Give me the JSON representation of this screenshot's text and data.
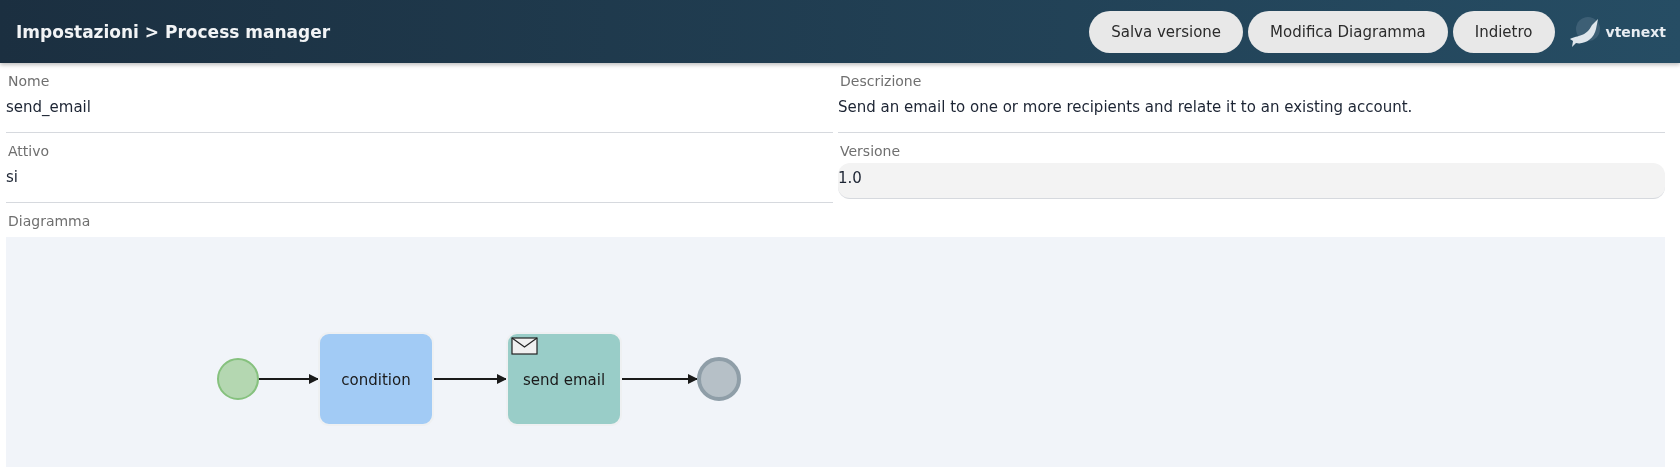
{
  "header": {
    "breadcrumb": "Impostazioni > Process manager",
    "buttons": [
      "Salva versione",
      "Modifica Diagramma",
      "Indietro"
    ],
    "logo": "vtenext"
  },
  "fields": [
    {
      "label": "Nome",
      "value": "send_email",
      "kind": "text"
    },
    {
      "label": "Descrizione",
      "value": "Send an email to one or more recipients and relate it to an existing account.",
      "kind": "text"
    },
    {
      "label": "Attivo",
      "value": "si",
      "kind": "text"
    },
    {
      "label": "Versione",
      "value": "1.0",
      "kind": "input"
    }
  ],
  "diagram": {
    "label": "Diagramma",
    "nodes": [
      {
        "kind": "start"
      },
      {
        "kind": "task",
        "label": "condition",
        "color": "#a2cbf5"
      },
      {
        "kind": "send_task",
        "label": "send email",
        "color": "#99cdc8"
      },
      {
        "kind": "end"
      }
    ]
  }
}
